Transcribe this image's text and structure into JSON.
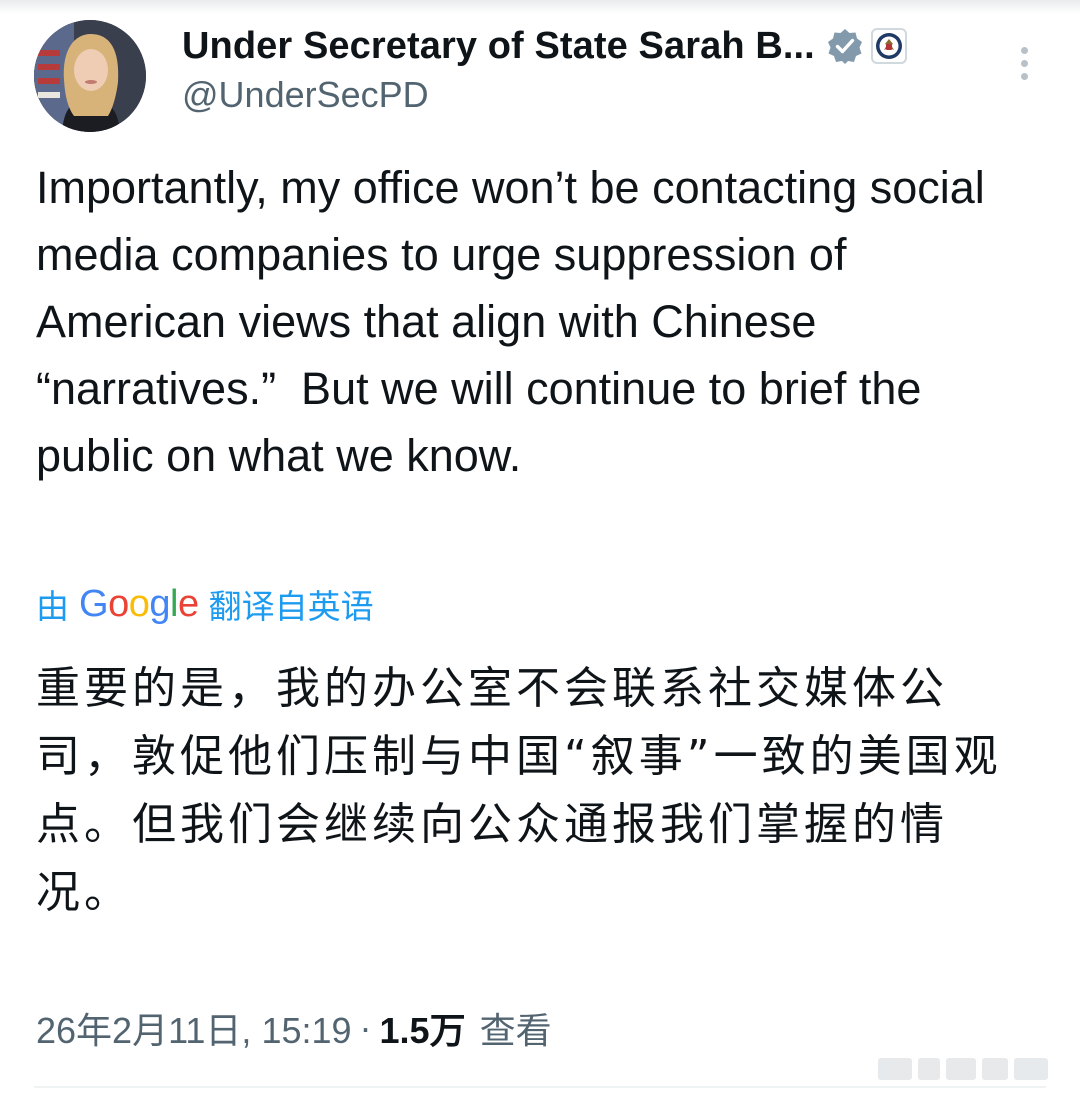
{
  "author": {
    "display_name": "Under Secretary of State Sarah B...",
    "handle": "@UnderSecPD",
    "avatar_icon": "profile-photo",
    "verified_icon": "verified-badge-icon",
    "affiliate_icon": "state-department-seal-icon"
  },
  "menu": {
    "more_icon": "more-vertical-icon"
  },
  "tweet": {
    "text": "Importantly, my office won’t be contacting social media companies to urge suppression of American views that align with Chinese “narratives.”  But we will continue to brief the public on what we know."
  },
  "translation": {
    "prefix": "由",
    "provider": "Google",
    "suffix": "翻译自英语",
    "text": "重要的是，我的办公室不会联系社交媒体公司，敦促他们压制与中国“叙事”一致的美国观点。但我们会继续向公众通报我们掌握的情况。"
  },
  "meta": {
    "timestamp": "26年2月11日, 15:19",
    "separator": "·",
    "views_count": "1.5万",
    "views_label": "查看"
  },
  "colors": {
    "text": "#0f1419",
    "secondary": "#536471",
    "link": "#1d9bf0",
    "verified": "#829aab"
  }
}
